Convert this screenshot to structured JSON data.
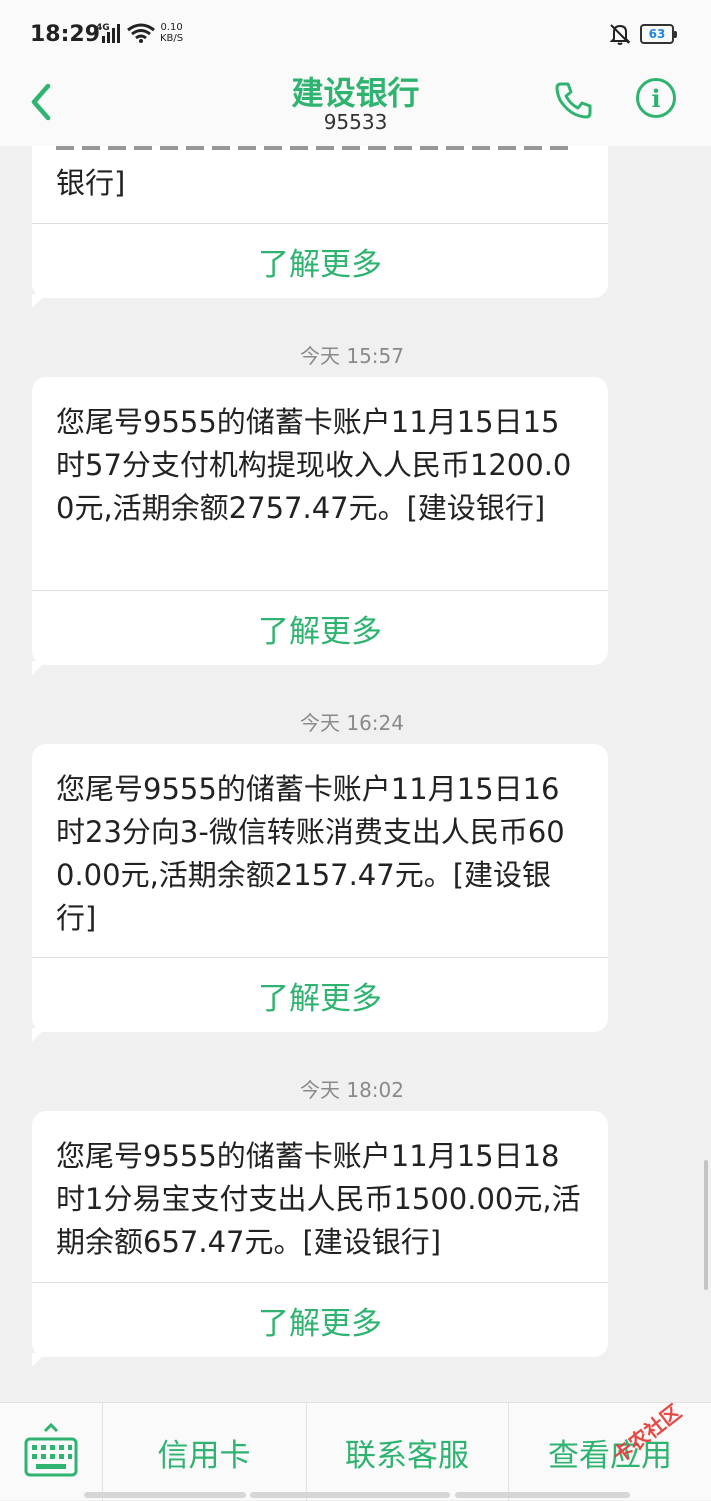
{
  "status_bar": {
    "time": "18:29",
    "network": "4G",
    "speed_value": "0.10",
    "speed_unit": "KB/S",
    "battery": "63"
  },
  "header": {
    "title": "建设银行",
    "number": "95533"
  },
  "messages": [
    {
      "text": "银行]",
      "link": "了解更多"
    },
    {
      "time": "今天 15:57",
      "text": "您尾号9555的储蓄卡账户11月15日15时57分支付机构提现收入人民币1200.00元,活期余额2757.47元。[建设银行]",
      "link": "了解更多"
    },
    {
      "time": "今天 16:24",
      "text": "您尾号9555的储蓄卡账户11月15日16时23分向3-微信转账消费支出人民币600.00元,活期余额2157.47元。[建设银行]",
      "link": "了解更多"
    },
    {
      "time": "今天 18:02",
      "text": "您尾号9555的储蓄卡账户11月15日18时1分易宝支付支出人民币1500.00元,活期余额657.47元。[建设银行]",
      "link": "了解更多"
    }
  ],
  "bottom_menu": {
    "items": [
      "信用卡",
      "联系客服",
      "查看应用"
    ]
  },
  "watermark": "卡农社区",
  "colors": {
    "accent": "#2fb370",
    "background": "#f0f0f0"
  }
}
